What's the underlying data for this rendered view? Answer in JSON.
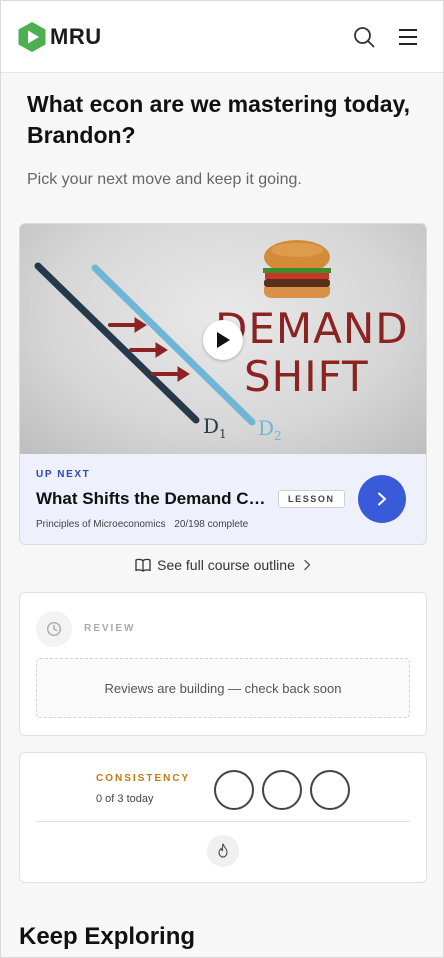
{
  "header": {
    "logo_text": "MRU",
    "logo_icon": "play-hexagon-icon",
    "search_icon": "search-icon",
    "menu_icon": "hamburger-menu-icon",
    "brand_color": "#4caf50"
  },
  "greeting": {
    "title": "What econ are we mastering today, Brandon?",
    "subtitle": "Pick your next move and keep it going."
  },
  "up_next": {
    "thumbnail_text_line1": "DEMAND",
    "thumbnail_text_line2": "SHIFT",
    "thumbnail_d1": "D",
    "thumbnail_d1_sub": "1",
    "thumbnail_d2": "D",
    "thumbnail_d2_sub": "2",
    "label": "UP NEXT",
    "title": "What Shifts the Demand Curve?",
    "badge": "LESSON",
    "course": "Principles of Microeconomics",
    "progress": "20/198 complete",
    "accent_color": "#3a5bd9"
  },
  "outline_link": "See full course outline",
  "review": {
    "label": "REVIEW",
    "empty_message": "Reviews are building — check back soon"
  },
  "consistency": {
    "label": "CONSISTENCY",
    "count": "0 of 3 today",
    "completed": 0,
    "goal": 3,
    "label_color": "#c27a12"
  },
  "keep_exploring": {
    "title": "Keep Exploring"
  }
}
